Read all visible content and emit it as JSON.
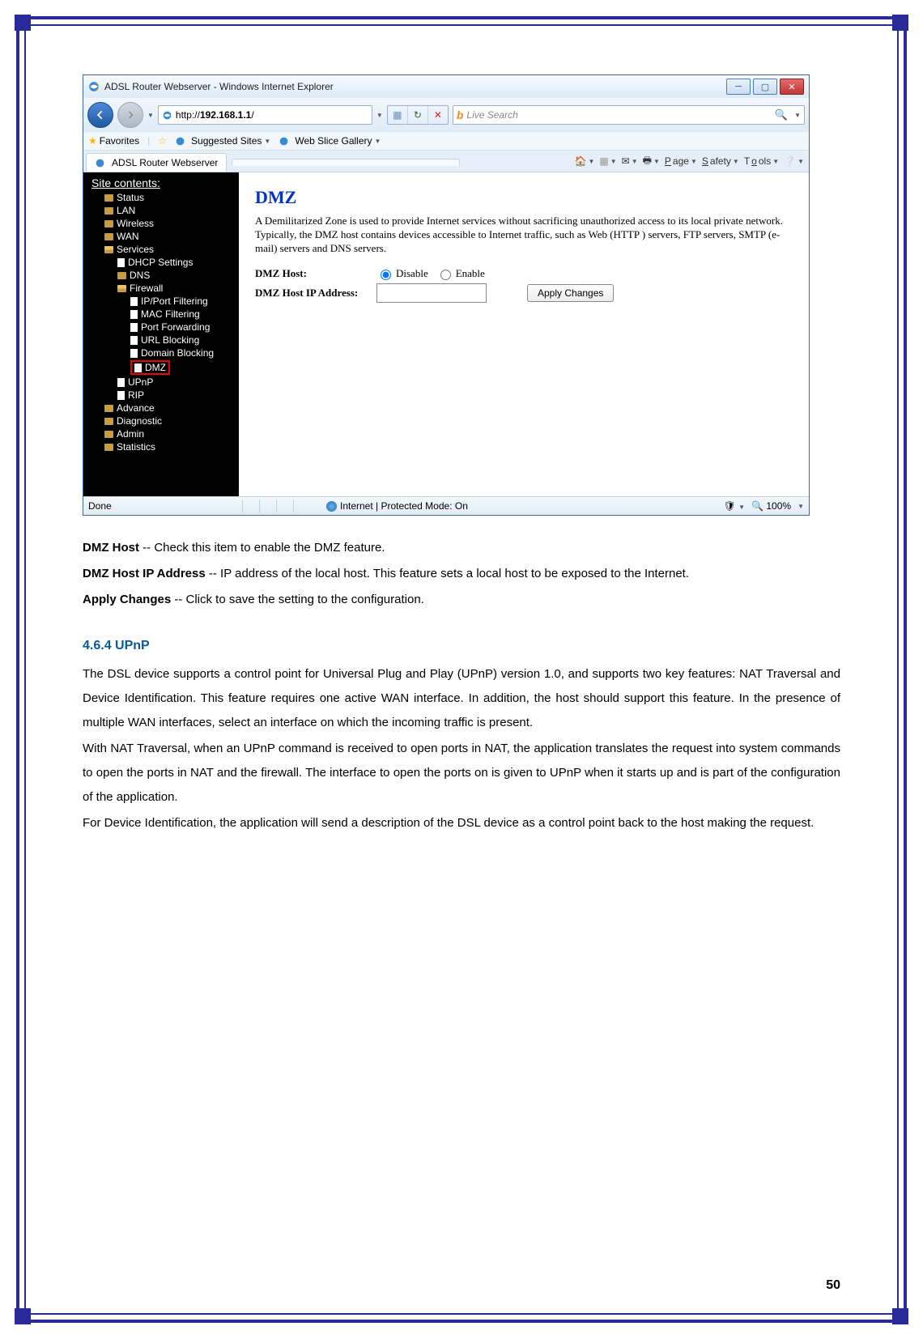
{
  "window": {
    "title": "ADSL Router Webserver - Windows Internet Explorer"
  },
  "nav": {
    "url": "http://192.168.1.1/",
    "searchPlaceholder": "Live Search"
  },
  "favorites": {
    "label": "Favorites",
    "suggested": "Suggested Sites",
    "gallery": "Web Slice Gallery"
  },
  "tab": {
    "title": "ADSL Router Webserver"
  },
  "toolbar": {
    "page": "Page",
    "safety": "Safety",
    "tools": "Tools"
  },
  "sidebar": {
    "header": "Site contents:",
    "items": [
      "Status",
      "LAN",
      "Wireless",
      "WAN",
      "Services",
      "Advance",
      "Diagnostic",
      "Admin",
      "Statistics"
    ],
    "services": [
      "DHCP Settings",
      "DNS",
      "Firewall",
      "UPnP",
      "RIP"
    ],
    "firewall": [
      "IP/Port Filtering",
      "MAC Filtering",
      "Port Forwarding",
      "URL Blocking",
      "Domain Blocking",
      "DMZ"
    ]
  },
  "content": {
    "title": "DMZ",
    "description": "A Demilitarized Zone is used to provide Internet services without sacrificing unauthorized access to its local private network. Typically, the DMZ host contains devices accessible to Internet traffic, such as Web (HTTP ) servers, FTP servers, SMTP (e-mail) servers and DNS servers.",
    "dmzHostLabel": "DMZ Host:",
    "disable": "Disable",
    "enable": "Enable",
    "ipLabel": "DMZ Host IP Address:",
    "ipValue": "",
    "applyBtn": "Apply Changes"
  },
  "status": {
    "done": "Done",
    "mode": "Internet | Protected Mode: On",
    "zoom": "100%"
  },
  "doc": {
    "p1a": "DMZ Host",
    "p1b": " -- Check this item to enable the DMZ feature.",
    "p2a": "DMZ Host IP Address",
    "p2b": " -- IP address of the local host. This feature sets a local host to be exposed to the Internet.",
    "p3a": "Apply Changes",
    "p3b": " -- Click to save the setting to the configuration.",
    "heading": "4.6.4 UPnP",
    "p4": "The DSL device supports a control point for Universal Plug and Play (UPnP) version 1.0, and supports two key features: NAT Traversal and Device Identification. This feature requires one active WAN interface. In addition, the host should support this feature. In the presence of multiple WAN interfaces, select an interface on which the incoming traffic is present.",
    "p5": "With NAT Traversal, when an UPnP command is received to open ports in NAT, the application translates the request into system commands to open the ports in NAT and the firewall. The interface to open the ports on is given to UPnP when it starts up and is part of the configuration of the application.",
    "p6": "For Device Identification, the application will send a description of the DSL device as a control point back to the host making the request."
  },
  "pageNumber": "50"
}
